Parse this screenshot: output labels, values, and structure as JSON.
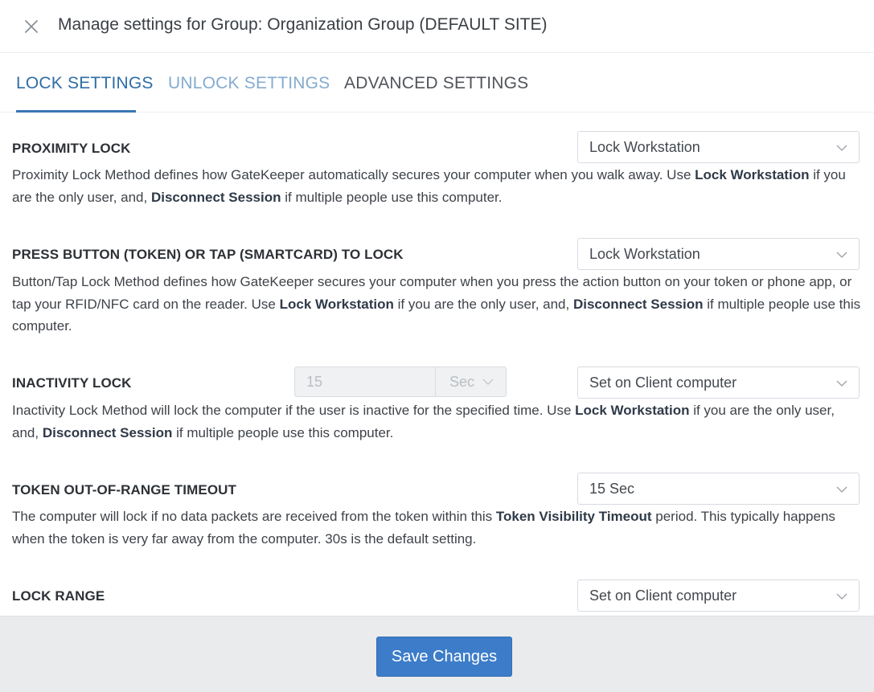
{
  "header": {
    "title": "Manage settings for Group: Organization Group (DEFAULT SITE)",
    "close_icon": "close-icon"
  },
  "tabs": [
    {
      "label": "LOCK SETTINGS",
      "active": true
    },
    {
      "label": "UNLOCK SETTINGS",
      "active": false
    },
    {
      "label": "ADVANCED SETTINGS",
      "active": false
    }
  ],
  "sections": {
    "proximity": {
      "title": "PROXIMITY LOCK",
      "select_value": "Lock Workstation",
      "desc_1": "Proximity Lock Method defines how GateKeeper automatically secures your computer when you walk away. Use ",
      "desc_b1": "Lock Workstation",
      "desc_2": " if you are the only user, and, ",
      "desc_b2": "Disconnect Session",
      "desc_3": " if multiple people use this computer."
    },
    "button": {
      "title": "PRESS BUTTON (TOKEN) OR TAP (SMARTCARD) TO LOCK",
      "select_value": "Lock Workstation",
      "desc_1": "Button/Tap Lock Method defines how GateKeeper secures your computer when you press the action button on your token or phone app, or tap your RFID/NFC card on the reader. Use ",
      "desc_b1": "Lock Workstation",
      "desc_2": " if you are the only user, and, ",
      "desc_b2": "Disconnect Session",
      "desc_3": " if multiple people use this computer."
    },
    "inactivity": {
      "title": "INACTIVITY LOCK",
      "number_value": "15",
      "unit_value": "Sec",
      "select_value": "Set on Client computer",
      "desc_1": "Inactivity Lock Method will lock the computer if the user is inactive for the specified time. Use ",
      "desc_b1": "Lock Workstation",
      "desc_2": " if you are the only user, and, ",
      "desc_b2": "Disconnect Session",
      "desc_3": " if multiple people use this computer."
    },
    "timeout": {
      "title": "TOKEN OUT-OF-RANGE TIMEOUT",
      "select_value": "15 Sec",
      "desc_1": "The computer will lock if no data packets are received from the token within this ",
      "desc_b1": "Token Visibility Timeout",
      "desc_2": " period. This typically happens when the token is very far away from the computer. 30s is the default setting."
    },
    "range": {
      "title": "LOCK RANGE",
      "select_value": "Set on Client computer"
    }
  },
  "footer": {
    "save_label": "Save Changes",
    "save_color": "#3c7cc9"
  },
  "colors": {
    "active_tab": "#2f6da6",
    "inactive_tab_light": "#84abcf",
    "inactive_tab": "#50555b"
  }
}
